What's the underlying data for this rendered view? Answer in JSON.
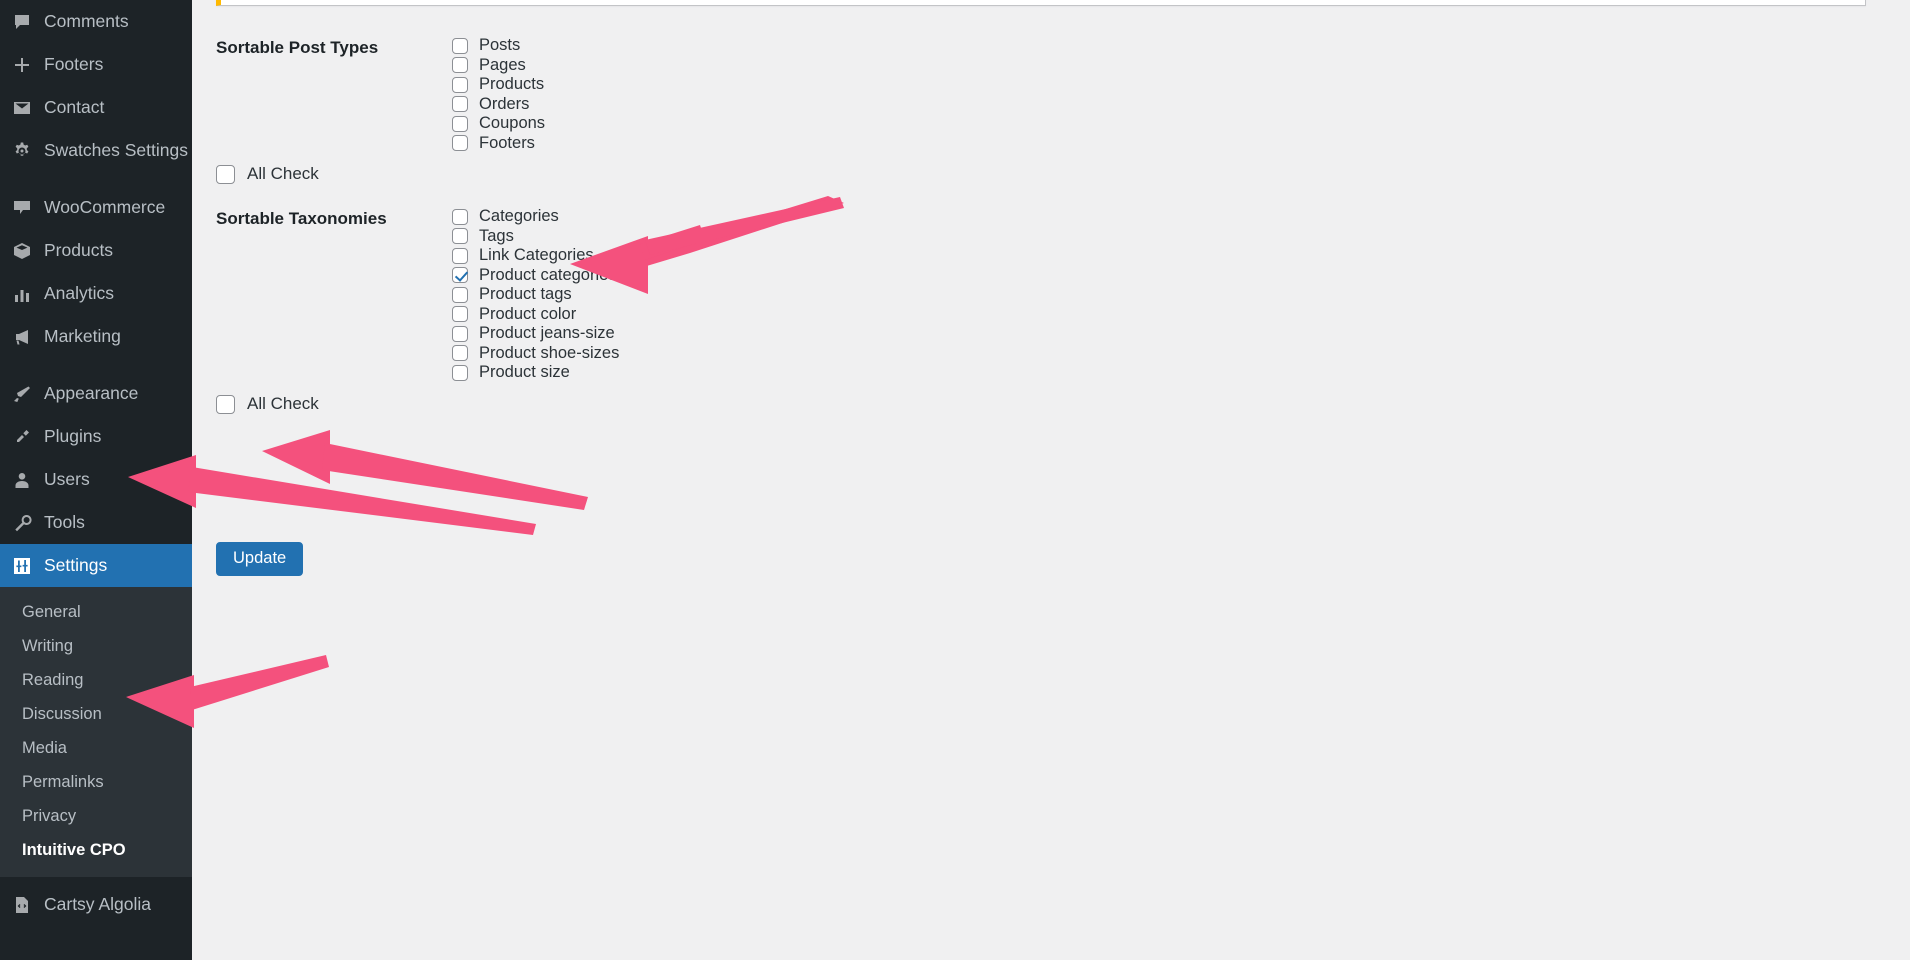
{
  "sidebar": {
    "items": [
      {
        "label": "Comments",
        "icon": "comments-icon",
        "id": "comments"
      },
      {
        "label": "Footers",
        "icon": "plus-icon",
        "id": "footers"
      },
      {
        "label": "Contact",
        "icon": "envelope-icon",
        "id": "contact"
      },
      {
        "label": "Swatches Settings",
        "icon": "gear-icon",
        "id": "swatches-settings"
      },
      {
        "label": "WooCommerce",
        "icon": "woo-icon",
        "id": "woocommerce"
      },
      {
        "label": "Products",
        "icon": "box-icon",
        "id": "products"
      },
      {
        "label": "Analytics",
        "icon": "bar-chart-icon",
        "id": "analytics"
      },
      {
        "label": "Marketing",
        "icon": "megaphone-icon",
        "id": "marketing"
      },
      {
        "label": "Appearance",
        "icon": "paintbrush-icon",
        "id": "appearance"
      },
      {
        "label": "Plugins",
        "icon": "plug-icon",
        "id": "plugins"
      },
      {
        "label": "Users",
        "icon": "user-icon",
        "id": "users"
      },
      {
        "label": "Tools",
        "icon": "wrench-icon",
        "id": "tools"
      },
      {
        "label": "Settings",
        "icon": "sliders-icon",
        "id": "settings",
        "active": true
      }
    ],
    "submenu": [
      {
        "label": "General",
        "current": false
      },
      {
        "label": "Writing",
        "current": false
      },
      {
        "label": "Reading",
        "current": false
      },
      {
        "label": "Discussion",
        "current": false
      },
      {
        "label": "Media",
        "current": false
      },
      {
        "label": "Permalinks",
        "current": false
      },
      {
        "label": "Privacy",
        "current": false
      },
      {
        "label": "Intuitive CPO",
        "current": true
      }
    ],
    "after_submenu": [
      {
        "label": "Cartsy Algolia",
        "icon": "code-file-icon",
        "id": "cartsy-algolia"
      }
    ],
    "active_color": "#2271b1"
  },
  "main": {
    "post_types": {
      "label": "Sortable Post Types",
      "options": [
        {
          "label": "Posts",
          "checked": false
        },
        {
          "label": "Pages",
          "checked": false
        },
        {
          "label": "Products",
          "checked": false
        },
        {
          "label": "Orders",
          "checked": false
        },
        {
          "label": "Coupons",
          "checked": false
        },
        {
          "label": "Footers",
          "checked": false
        }
      ],
      "all_check_label": "All Check",
      "all_check_checked": false
    },
    "taxonomies": {
      "label": "Sortable Taxonomies",
      "options": [
        {
          "label": "Categories",
          "checked": false
        },
        {
          "label": "Tags",
          "checked": false
        },
        {
          "label": "Link Categories",
          "checked": false
        },
        {
          "label": "Product categories",
          "checked": true
        },
        {
          "label": "Product tags",
          "checked": false
        },
        {
          "label": "Product color",
          "checked": false
        },
        {
          "label": "Product jeans-size",
          "checked": false
        },
        {
          "label": "Product shoe-sizes",
          "checked": false
        },
        {
          "label": "Product size",
          "checked": false
        }
      ],
      "all_check_label": "All Check",
      "all_check_checked": false
    },
    "update_button": "Update",
    "button_color": "#2271b1",
    "notice_accent": "#ffb900"
  },
  "annotations": {
    "arrow_color": "#f4517d",
    "arrows": [
      {
        "name": "arrow-to-product-categories-checkbox"
      },
      {
        "name": "arrow-to-update-button"
      },
      {
        "name": "arrow-to-settings-menu"
      },
      {
        "name": "arrow-to-intuitive-cpo-submenu"
      }
    ]
  }
}
